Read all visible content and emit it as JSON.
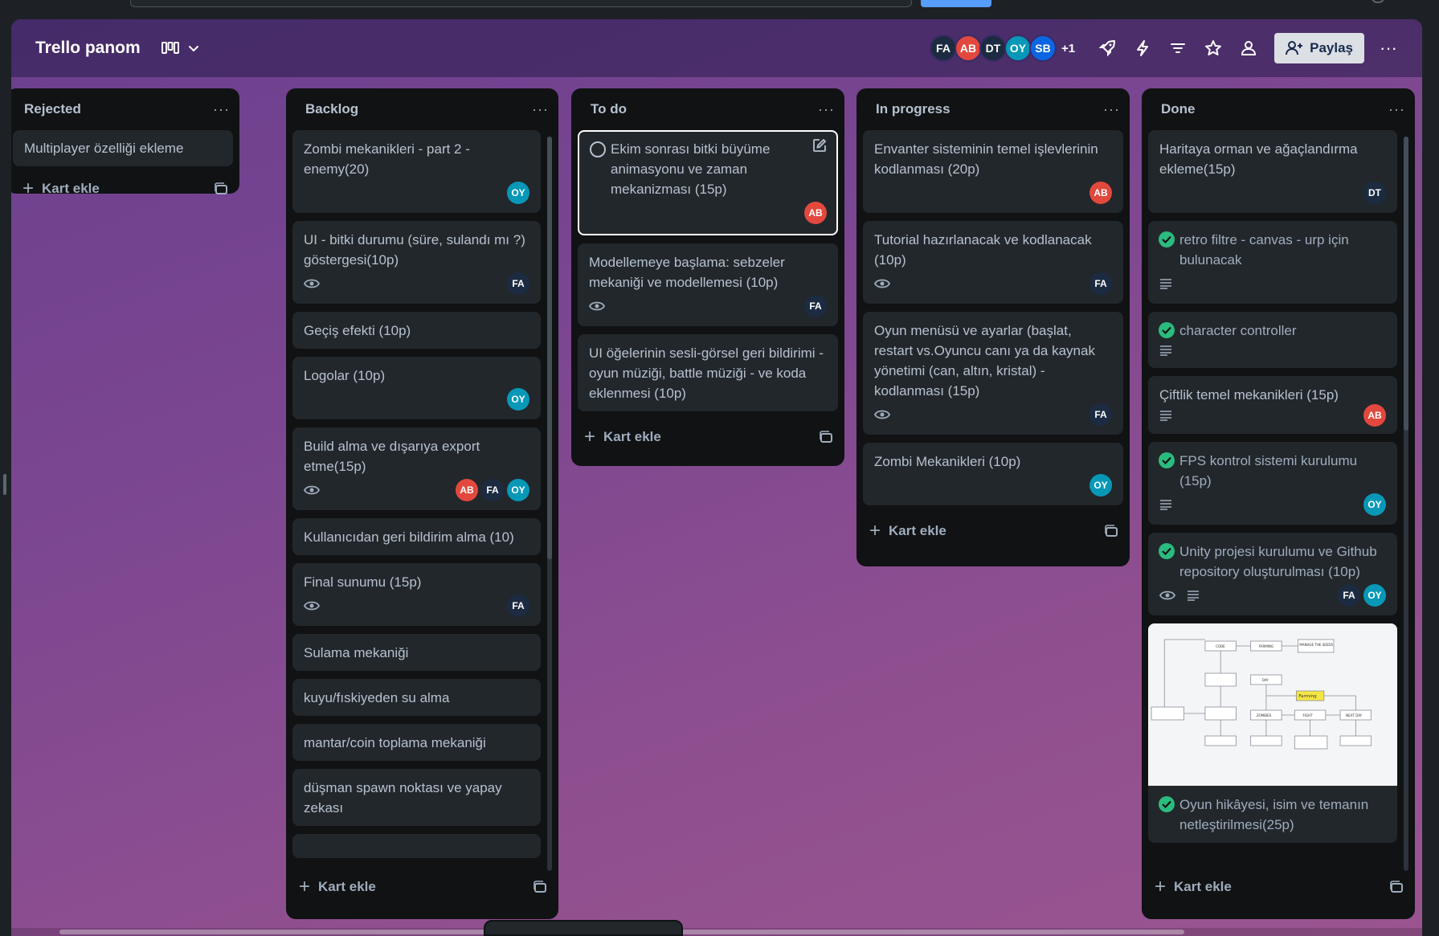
{
  "board": {
    "title": "Trello panom",
    "members": [
      {
        "initials": "FA",
        "color": "#1c2b41"
      },
      {
        "initials": "AB",
        "color": "#e2483d"
      },
      {
        "initials": "DT",
        "color": "#1c2b41"
      },
      {
        "initials": "OY",
        "color": "#0798b8"
      },
      {
        "initials": "SB",
        "color": "#0c66e4"
      }
    ],
    "members_extra": "+1",
    "share_label": "Paylaş",
    "more_label": "···",
    "list_menu": "···",
    "add_card_label": "Kart ekle",
    "check_color": "#2abb7f"
  },
  "lists": {
    "rejected": {
      "title": "Rejected",
      "cards": [
        {
          "text": "Multiplayer özelliği ekleme"
        }
      ]
    },
    "backlog": {
      "title": "Backlog",
      "cards": [
        {
          "text": "Zombi mekanikleri - part 2 - enemy(20)",
          "members": [
            "OY"
          ]
        },
        {
          "text": "UI - bitki durumu (süre, sulandı mı ?) göstergesi(10p)",
          "watch": true,
          "members": [
            "FA"
          ]
        },
        {
          "text": "Geçiş efekti (10p)"
        },
        {
          "text": "Logolar (10p)",
          "members": [
            "OY"
          ]
        },
        {
          "text": "Build alma ve dışarıya export etme(15p)",
          "watch": true,
          "members": [
            "AB",
            "FA",
            "OY"
          ]
        },
        {
          "text": "Kullanıcıdan geri bildirim alma (10)"
        },
        {
          "text": "Final sunumu (15p)",
          "watch": true,
          "members": [
            "FA"
          ]
        },
        {
          "text": "Sulama mekaniği"
        },
        {
          "text": "kuyu/fıskiyeden su alma"
        },
        {
          "text": "mantar/coin toplama mekaniği"
        },
        {
          "text": "düşman spawn noktası ve yapay zekası"
        }
      ]
    },
    "todo": {
      "title": "To do",
      "cards": [
        {
          "text": "Ekim sonrası bitki büyüme animasyonu ve zaman mekanizması (15p)",
          "members": [
            "AB"
          ]
        },
        {
          "text": "Modellemeye başlama: sebzeler mekaniği ve modellemesi (10p)",
          "watch": true,
          "members": [
            "FA"
          ]
        },
        {
          "text": "UI öğelerinin sesli-görsel geri bildirimi - oyun müziği, battle müziği - ve koda eklenmesi (10p)"
        }
      ]
    },
    "inprogress": {
      "title": "In progress",
      "cards": [
        {
          "text": "Envanter sisteminin temel işlevlerinin kodlanması (20p)",
          "members": [
            "AB"
          ]
        },
        {
          "text": "Tutorial hazırlanacak ve kodlanacak (10p)",
          "watch": true,
          "members": [
            "FA"
          ]
        },
        {
          "text": "Oyun menüsü ve ayarlar (başlat, restart vs.Oyuncu canı ya da kaynak yönetimi (can, altın, kristal) - kodlanması (15p)",
          "watch": true,
          "members": [
            "FA"
          ]
        },
        {
          "text": "Zombi Mekanikleri (10p)",
          "members": [
            "OY"
          ]
        }
      ]
    },
    "done": {
      "title": "Done",
      "cards": [
        {
          "text": "Haritaya orman ve ağaçlandırma ekleme(15p)",
          "members": [
            "DT"
          ]
        },
        {
          "text": "retro filtre - canvas - urp için bulunacak",
          "complete": true,
          "description": true
        },
        {
          "text": "character controller",
          "complete": true,
          "description": true
        },
        {
          "text": "Çiftlik temel mekanikleri (15p)",
          "description": true,
          "members": [
            "AB"
          ]
        },
        {
          "text": "FPS kontrol sistemi kurulumu (15p)",
          "complete": true,
          "description": true,
          "members": [
            "OY"
          ]
        },
        {
          "text": "Unity projesi kurulumu ve Github repository oluşturulması (10p)",
          "complete": true,
          "watch": true,
          "description": true,
          "members": [
            "FA",
            "OY"
          ]
        },
        {
          "text": "Oyun hikâyesi, isim ve temanın netleştirilmesi(25p)",
          "complete": true,
          "image": true
        }
      ],
      "image_labels": {
        "top1": "CODE",
        "top2": "FARMING",
        "top3": "MANAGE THE SEEDS",
        "day": "DAY",
        "farming": "Farming",
        "mid1": "ZOMBIES",
        "mid2": "FIGHT",
        "mid3": "NEXT DAY"
      }
    }
  }
}
